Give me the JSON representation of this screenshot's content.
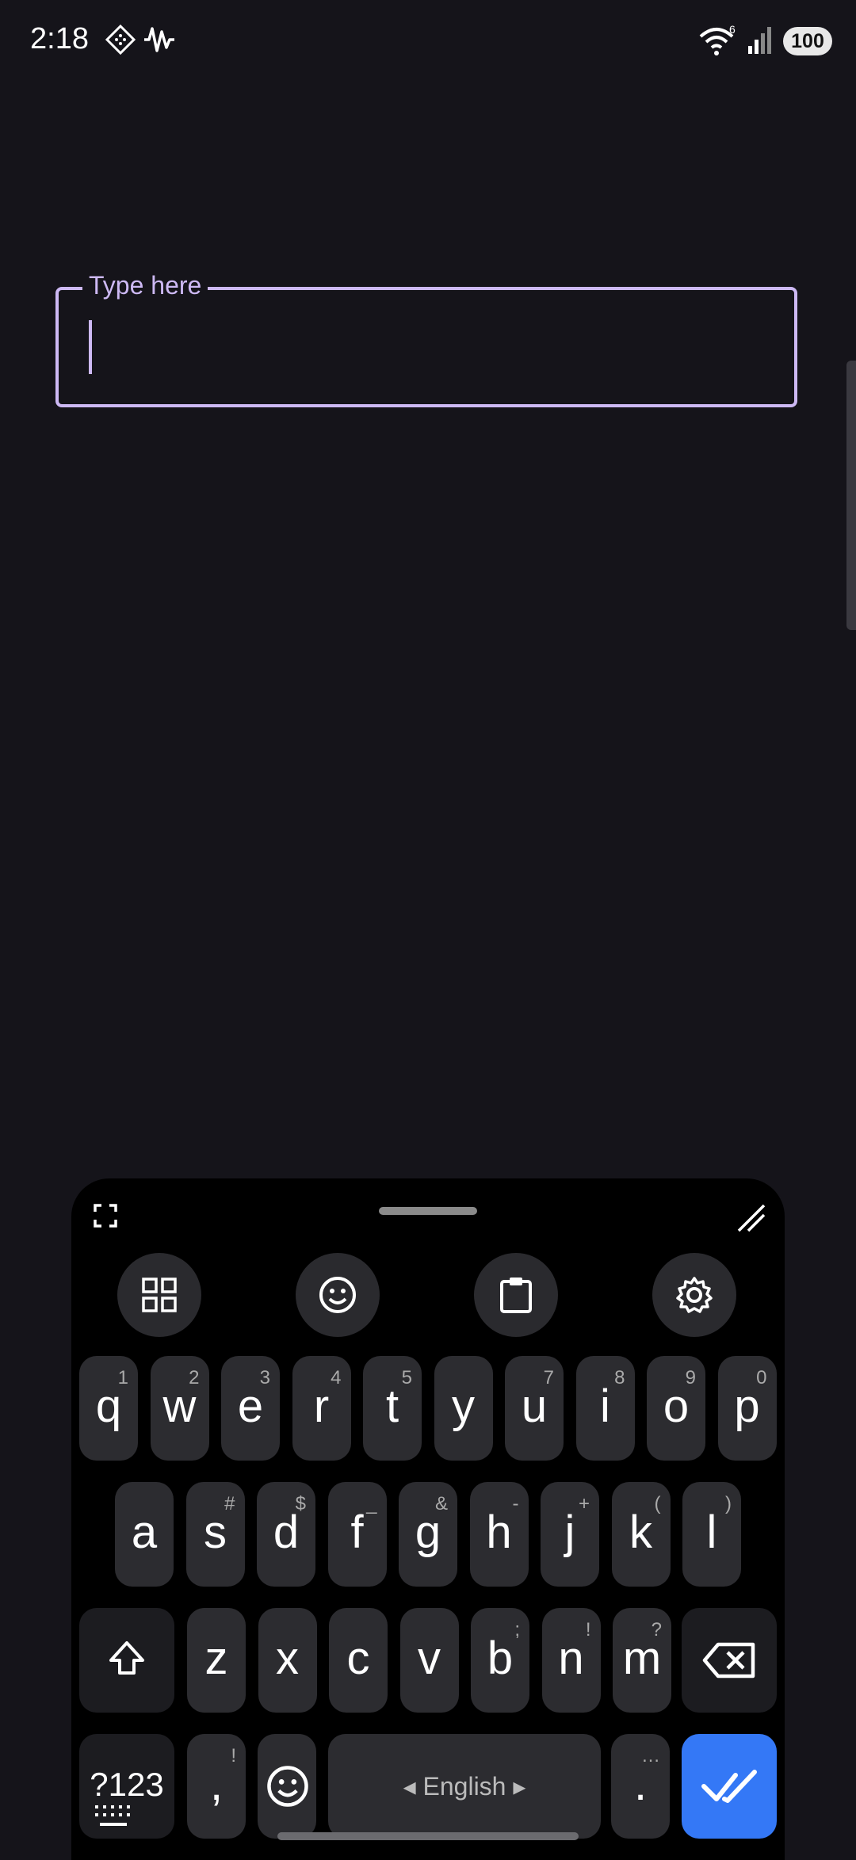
{
  "status_bar": {
    "time": "2:18",
    "battery": "100",
    "wifi_badge": "6",
    "icons": [
      "diamond-icon",
      "waveform-icon",
      "wifi-icon",
      "signal-icon",
      "battery-icon"
    ]
  },
  "text_field": {
    "label": "Type here",
    "value": "",
    "placeholder": ""
  },
  "keyboard": {
    "toolbar": [
      "grid-icon",
      "emoji-icon",
      "clipboard-icon",
      "settings-icon"
    ],
    "row1": [
      {
        "key": "q",
        "hint": "1"
      },
      {
        "key": "w",
        "hint": "2"
      },
      {
        "key": "e",
        "hint": "3"
      },
      {
        "key": "r",
        "hint": "4"
      },
      {
        "key": "t",
        "hint": "5"
      },
      {
        "key": "y",
        "hint": ""
      },
      {
        "key": "u",
        "hint": "7"
      },
      {
        "key": "i",
        "hint": "8"
      },
      {
        "key": "o",
        "hint": "9"
      },
      {
        "key": "p",
        "hint": "0"
      }
    ],
    "row2": [
      {
        "key": "a",
        "hint": ""
      },
      {
        "key": "s",
        "hint": "#"
      },
      {
        "key": "d",
        "hint": "$"
      },
      {
        "key": "f",
        "hint": "_"
      },
      {
        "key": "g",
        "hint": "&"
      },
      {
        "key": "h",
        "hint": "-"
      },
      {
        "key": "j",
        "hint": "+"
      },
      {
        "key": "k",
        "hint": "("
      },
      {
        "key": "l",
        "hint": ")"
      }
    ],
    "row3": [
      {
        "key": "z",
        "hint": ""
      },
      {
        "key": "x",
        "hint": ""
      },
      {
        "key": "c",
        "hint": ""
      },
      {
        "key": "v",
        "hint": ""
      },
      {
        "key": "b",
        "hint": ";"
      },
      {
        "key": "n",
        "hint": "!"
      },
      {
        "key": "m",
        "hint": "?"
      }
    ],
    "symbols_label": "?123",
    "comma": ",",
    "comma_hint": "!",
    "period": ".",
    "period_hint": "…",
    "space_label": "◂  English  ▸"
  },
  "colors": {
    "background": "#15141a",
    "accent": "#cdb9f4",
    "key": "#2c2c30",
    "enter": "#3478f6"
  }
}
